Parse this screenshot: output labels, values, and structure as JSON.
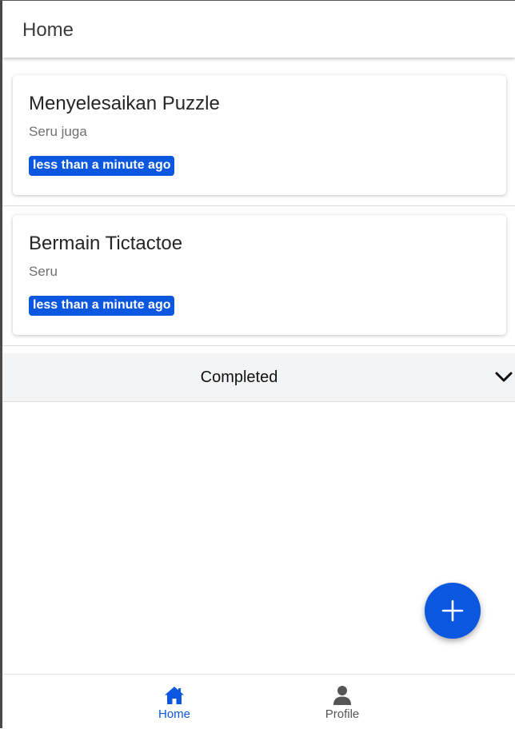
{
  "header": {
    "title": "Home"
  },
  "tasks": [
    {
      "title": "Menyelesaikan Puzzle",
      "description": "Seru juga",
      "time": "less than a minute ago"
    },
    {
      "title": "Bermain Tictactoe",
      "description": "Seru",
      "time": "less than a minute ago"
    }
  ],
  "completed_section": {
    "label": "Completed",
    "icon": "chevron-down-icon"
  },
  "fab": {
    "icon": "plus-icon"
  },
  "bottom_nav": {
    "home": {
      "label": "Home",
      "icon": "home-icon"
    },
    "profile": {
      "label": "Profile",
      "icon": "person-icon"
    }
  },
  "colors": {
    "accent": "#0b57e0",
    "section_bg": "#f3f4f6",
    "badge_text": "#ffffff"
  }
}
